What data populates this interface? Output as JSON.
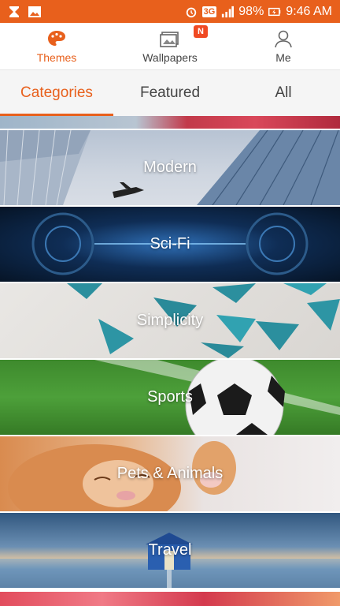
{
  "status_bar": {
    "battery_percent": "98%",
    "network": "3G",
    "time": "9:46 AM",
    "bg_color": "#e8601c"
  },
  "top_nav": {
    "tabs": [
      {
        "label": "Themes",
        "icon": "palette-icon",
        "active": true
      },
      {
        "label": "Wallpapers",
        "icon": "wallpaper-icon",
        "active": false
      },
      {
        "label": "Me",
        "icon": "person-icon",
        "active": false
      }
    ],
    "new_badge": "N",
    "accent_color": "#e8601c"
  },
  "sub_tabs": [
    {
      "label": "Categories",
      "active": true
    },
    {
      "label": "Featured",
      "active": false
    },
    {
      "label": "All",
      "active": false
    }
  ],
  "categories": [
    {
      "label": "Modern"
    },
    {
      "label": "Sci-Fi"
    },
    {
      "label": "Simplicity"
    },
    {
      "label": "Sports"
    },
    {
      "label": "Pets & Animals"
    },
    {
      "label": "Travel"
    }
  ]
}
